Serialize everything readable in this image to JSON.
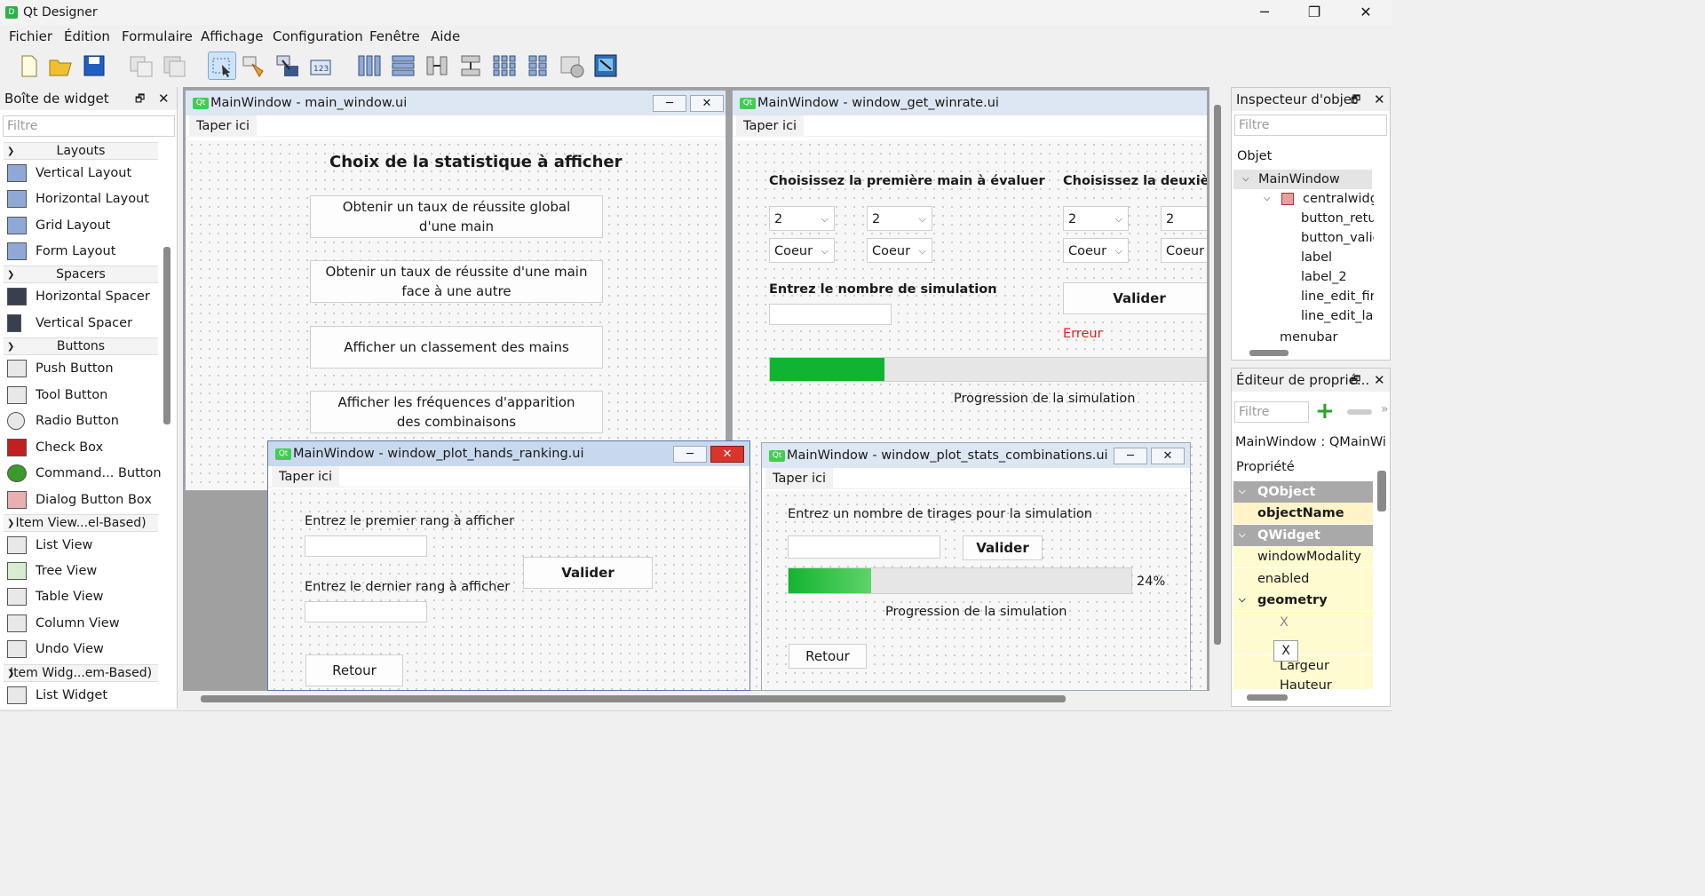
{
  "app": {
    "title": "Qt Designer",
    "icon_text": "D"
  },
  "window_controls": {
    "minimize": "─",
    "maximize": "❐",
    "close": "✕"
  },
  "menubar": [
    "Fichier",
    "Édition",
    "Formulaire",
    "Affichage",
    "Configuration",
    "Fenêtre",
    "Aide"
  ],
  "toolbar": {
    "icons": [
      "new-file-icon",
      "open-folder-icon",
      "save-icon",
      "copy-icon",
      "paste-icon",
      "widget-edit-mode-icon",
      "signal-slot-icon",
      "buddy-icon",
      "tab-order-icon",
      "layout-horizontal-icon",
      "layout-vertical-icon",
      "splitter-horizontal-icon",
      "splitter-vertical-icon",
      "layout-grid-icon",
      "layout-form-icon",
      "break-layout-icon",
      "adjust-size-icon"
    ]
  },
  "widget_box": {
    "title": "Boîte de widget",
    "filter_placeholder": "Filtre",
    "categories": {
      "layouts": "Layouts",
      "spacers": "Spacers",
      "buttons": "Buttons",
      "item_view": "Item View...el-Based)",
      "item_widget": "Item Widg...em-Based)"
    },
    "items": {
      "vertical_layout": "Vertical Layout",
      "horizontal_layout": "Horizontal Layout",
      "grid_layout": "Grid Layout",
      "form_layout": "Form Layout",
      "horizontal_spacer": "Horizontal Spacer",
      "vertical_spacer": "Vertical Spacer",
      "push_button": "Push Button",
      "tool_button": "Tool Button",
      "radio_button": "Radio Button",
      "check_box": "Check Box",
      "command_button": "Command... Button",
      "dialog_button_box": "Dialog Button Box",
      "list_view": "List View",
      "tree_view": "Tree View",
      "table_view": "Table View",
      "column_view": "Column View",
      "undo_view": "Undo View",
      "list_widget": "List Widget"
    }
  },
  "subwin_main": {
    "title": "MainWindow - main_window.ui",
    "menu_placeholder": "Taper ici",
    "heading": "Choix de la statistique à afficher",
    "btn1_line1": "Obtenir un taux de réussite global",
    "btn1_line2": "d'une main",
    "btn2_line1": "Obtenir un taux de réussite d'une main",
    "btn2_line2": "face à une autre",
    "btn3": "Afficher un classement des mains",
    "btn4_line1": "Afficher les fréquences d'apparition",
    "btn4_line2": "des combinaisons"
  },
  "subwin_winrate": {
    "title": "MainWindow - window_get_winrate.ui",
    "menu_placeholder": "Taper ici",
    "label_first": "Choisissez la première main à évaluer",
    "label_second": "Choisissez la deuxième m",
    "combo_rank1": "2",
    "combo_rank2": "2",
    "combo_rank3": "2",
    "combo_rank4": "2",
    "combo_suit1": "Coeur",
    "combo_suit2": "Coeur",
    "combo_suit3": "Coeur",
    "combo_suit4": "Coeur",
    "label_nb_sim": "Entrez le nombre de simulation",
    "validate": "Valider",
    "error": "Erreur",
    "progress_label": "Progression de la simulation",
    "progress_fraction": 0.26
  },
  "subwin_ranking": {
    "title": "MainWindow - window_plot_hands_ranking.ui",
    "menu_placeholder": "Taper ici",
    "label_first_rank": "Entrez le premier rang à afficher",
    "label_last_rank": "Entrez le dernier rang à afficher",
    "validate": "Valider",
    "back": "Retour"
  },
  "subwin_combos": {
    "title": "MainWindow - window_plot_stats_combinations.ui",
    "menu_placeholder": "Taper ici",
    "label_draws": "Entrez un nombre de tirages pour la simulation",
    "validate": "Valider",
    "progress_text": "24%",
    "progress_fraction": 0.24,
    "progress_label": "Progression de la simulation",
    "back": "Retour"
  },
  "object_inspector": {
    "title": "Inspecteur d'objet",
    "filter_placeholder": "Filtre",
    "column_header": "Objet",
    "tree": {
      "root": "MainWindow",
      "central": "centralwidge",
      "c1": "button_retur",
      "c2": "button_valid",
      "c3": "label",
      "c4": "label_2",
      "c5": "line_edit_firs",
      "c6": "line_edit_last",
      "menubar": "menubar"
    }
  },
  "property_editor": {
    "title": "Éditeur de proprié...",
    "filter_placeholder": "Filtre",
    "object_label": "MainWindow : QMainWin...",
    "column_header": "Propriété",
    "qobject": "QObject",
    "object_name": "objectName",
    "qwidget": "QWidget",
    "window_modality": "windowModality",
    "enabled": "enabled",
    "geometry": "geometry",
    "x": "X",
    "y_tooltip": "X",
    "width": "Largeur",
    "height": "Hauteur"
  }
}
